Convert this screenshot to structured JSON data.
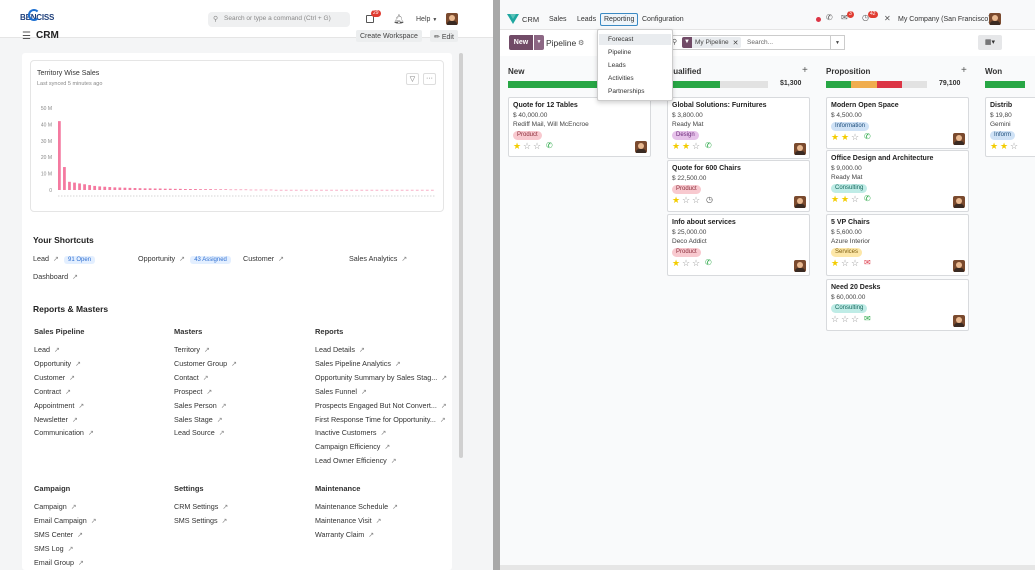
{
  "left": {
    "logo_text": "BENCISS",
    "search_placeholder": "Search or type a command (Ctrl + G)",
    "notif_count": "29",
    "help_label": "Help",
    "module_title": "CRM",
    "create_workspace_label": "Create Workspace",
    "edit_label": "Edit",
    "chart_card": {
      "title": "Territory Wise Sales",
      "subtitle": "Last synced 5 minutes ago"
    },
    "chart_data": {
      "type": "bar",
      "title": "Territory Wise Sales",
      "y_ticks": [
        "50 M",
        "40 M",
        "30 M",
        "20 M",
        "10 M",
        "0"
      ],
      "ylim": [
        0,
        50
      ],
      "values": [
        42,
        14,
        5,
        4.5,
        4,
        3.5,
        3,
        2.5,
        2.2,
        2,
        1.8,
        1.6,
        1.5,
        1.4,
        1.3,
        1.2,
        1.1,
        1.0,
        1.0,
        0.9,
        0.9,
        0.8,
        0.8,
        0.7,
        0.7,
        0.6,
        0.6,
        0.6,
        0.5,
        0.5,
        0.5,
        0.4,
        0.4,
        0.4,
        0.3,
        0.3,
        0.3,
        0.3,
        0.2,
        0.2,
        0.2,
        0.2,
        0.2,
        0.1,
        0.1,
        0.1,
        0.1,
        0.1,
        0.1,
        0.1,
        0.1,
        0.1,
        0.1,
        0.1,
        0.1,
        0.1,
        0.1,
        0.1,
        0.1,
        0.1,
        0.1,
        0.1,
        0.1,
        0.1,
        0.1,
        0.1,
        0.1,
        0.1,
        0.1,
        0.1,
        0.1,
        0.1,
        0.1,
        0.1,
        0.1
      ],
      "color": "#f47aa0"
    },
    "shortcuts": {
      "heading": "Your Shortcuts",
      "items": [
        {
          "label": "Lead",
          "badge": "91 Open"
        },
        {
          "label": "Opportunity",
          "badge": "43 Assigned"
        },
        {
          "label": "Customer",
          "badge": ""
        },
        {
          "label": "Sales Analytics",
          "badge": ""
        },
        {
          "label": "Dashboard",
          "badge": ""
        }
      ]
    },
    "reports_heading": "Reports & Masters",
    "sales_pipeline": {
      "heading": "Sales Pipeline",
      "items": [
        "Lead",
        "Opportunity",
        "Customer",
        "Contract",
        "Appointment",
        "Newsletter",
        "Communication"
      ]
    },
    "masters": {
      "heading": "Masters",
      "items": [
        "Territory",
        "Customer Group",
        "Contact",
        "Prospect",
        "Sales Person",
        "Sales Stage",
        "Lead Source"
      ]
    },
    "reports": {
      "heading": "Reports",
      "items": [
        "Lead Details",
        "Sales Pipeline Analytics",
        "Opportunity Summary by Sales Stag...",
        "Sales Funnel",
        "Prospects Engaged But Not Convert...",
        "First Response Time for Opportunity...",
        "Inactive Customers",
        "Campaign Efficiency",
        "Lead Owner Efficiency"
      ]
    },
    "campaign": {
      "heading": "Campaign",
      "items": [
        "Campaign",
        "Email Campaign",
        "SMS Center",
        "SMS Log",
        "Email Group"
      ]
    },
    "settings": {
      "heading": "Settings",
      "items": [
        "CRM Settings",
        "SMS Settings"
      ]
    },
    "maintenance": {
      "heading": "Maintenance",
      "items": [
        "Maintenance Schedule",
        "Maintenance Visit",
        "Warranty Claim"
      ]
    }
  },
  "right": {
    "app_name": "CRM",
    "menu": [
      "Sales",
      "Leads",
      "Reporting",
      "Configuration"
    ],
    "messages_count": "3",
    "activity_count": "42",
    "company": "My Company (San Francisco)",
    "new_label": "New",
    "pipeline_label": "Pipeline",
    "filter_facet": "My Pipeline",
    "search_placeholder": "Search...",
    "reporting_dropdown": [
      "Forecast",
      "Pipeline",
      "Leads",
      "Activities",
      "Partnerships"
    ],
    "columns": [
      {
        "name": "New",
        "total": "",
        "bar": [
          {
            "c": "#28a745",
            "w": 0.62
          },
          {
            "c": "#e2e2e2",
            "w": 0.38
          }
        ]
      },
      {
        "name": "Qualified",
        "total": "$1,300",
        "bar": [
          {
            "c": "#28a745",
            "w": 0.52
          },
          {
            "c": "#e2e2e2",
            "w": 0.48
          }
        ]
      },
      {
        "name": "Proposition",
        "total": "79,100",
        "bar": [
          {
            "c": "#28a745",
            "w": 0.25
          },
          {
            "c": "#f0ad4e",
            "w": 0.25
          },
          {
            "c": "#dc3545",
            "w": 0.25
          },
          {
            "c": "#e2e2e2",
            "w": 0.25
          }
        ]
      },
      {
        "name": "Won",
        "total": "",
        "bar": [
          {
            "c": "#28a745",
            "w": 1
          }
        ]
      }
    ],
    "cards": {
      "new": [
        {
          "title": "Quote for 12 Tables",
          "amount": "$ 40,000.00",
          "company": "Rediff Mail, Will McEncroe",
          "tag": "Product",
          "stars": 1,
          "activity": "phone"
        }
      ],
      "qualified": [
        {
          "title": "Global Solutions: Furnitures",
          "amount": "$ 3,800.00",
          "company": "Ready Mat",
          "tag": "Design",
          "stars": 2,
          "activity": "phone"
        },
        {
          "title": "Quote for 600 Chairs",
          "amount": "$ 22,500.00",
          "company": "",
          "tag": "Product",
          "stars": 1,
          "activity": "clock"
        },
        {
          "title": "Info about services",
          "amount": "$ 25,000.00",
          "company": "Deco Addict",
          "tag": "Product",
          "stars": 1,
          "activity": "phone"
        }
      ],
      "proposition": [
        {
          "title": "Modern Open Space",
          "amount": "$ 4,500.00",
          "company": "",
          "tag": "Information",
          "stars": 2,
          "activity": "phone"
        },
        {
          "title": "Office Design and Architecture",
          "amount": "$ 9,000.00",
          "company": "Ready Mat",
          "tag": "Consulting",
          "stars": 2,
          "activity": "phone"
        },
        {
          "title": "5 VP Chairs",
          "amount": "$ 5,600.00",
          "company": "Azure Interior",
          "tag": "Services",
          "stars": 1,
          "activity": "email-red"
        },
        {
          "title": "Need 20 Desks",
          "amount": "$ 60,000.00",
          "company": "",
          "tag": "Consulting",
          "stars": 0,
          "activity": "email-green"
        }
      ],
      "won": [
        {
          "title": "Distrib",
          "amount": "$ 19,80",
          "company": "Gemini",
          "tag": "Inform",
          "stars": 2,
          "activity": ""
        }
      ]
    },
    "tag_colors": {
      "Product": [
        "#f8c9cf",
        "#8a2d3a"
      ],
      "Design": [
        "#e6c2ea",
        "#6c2b7a"
      ],
      "Information": [
        "#cfe2f6",
        "#1f4e7a"
      ],
      "Inform": [
        "#cfe2f6",
        "#1f4e7a"
      ],
      "Consulting": [
        "#bfece6",
        "#14665c"
      ],
      "Services": [
        "#fde7a8",
        "#7a5a0c"
      ]
    }
  }
}
